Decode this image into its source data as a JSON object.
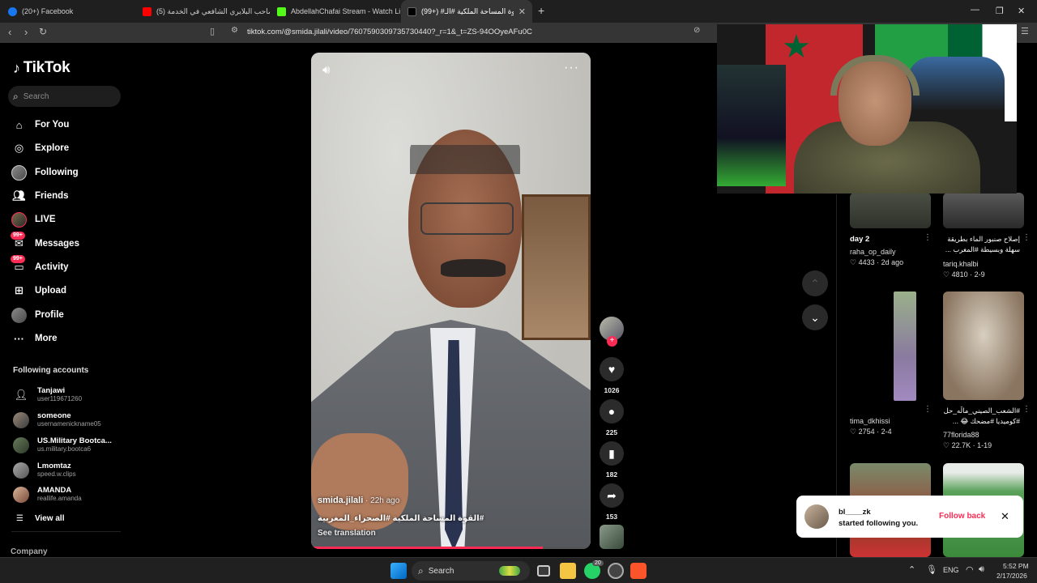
{
  "browser": {
    "tabs": [
      {
        "title": "(20+) Facebook",
        "color": "#1877f2"
      },
      {
        "title": "(5) صاحب البلايري الشافعي في الخدمة",
        "color": "#ff0000"
      },
      {
        "title": "AbdellahChafai Stream - Watch Live",
        "color": "#53fc18"
      },
      {
        "title": "(99+) #القوة المساحة الملكية #الـ",
        "color": "#000000"
      }
    ],
    "url": "tiktok.com/@smida.jilali/video/7607590309735730440?_r=1&_t=ZS-94OOyeAFu0C"
  },
  "sidebar": {
    "logo": "TikTok",
    "search_placeholder": "Search",
    "nav": [
      {
        "label": "For You",
        "icon": "home-icon"
      },
      {
        "label": "Explore",
        "icon": "compass-icon"
      },
      {
        "label": "Following",
        "icon": "avatar"
      },
      {
        "label": "Friends",
        "icon": "friends-icon"
      },
      {
        "label": "LIVE",
        "icon": "live-icon"
      },
      {
        "label": "Messages",
        "icon": "messages-icon",
        "badge": "99+"
      },
      {
        "label": "Activity",
        "icon": "activity-icon",
        "badge": "99+"
      },
      {
        "label": "Upload",
        "icon": "upload-icon"
      },
      {
        "label": "Profile",
        "icon": "avatar"
      },
      {
        "label": "More",
        "icon": "more-icon"
      }
    ],
    "following_title": "Following accounts",
    "accounts": [
      {
        "name": "Tanjawi",
        "user": "user119671260"
      },
      {
        "name": "someone",
        "user": "usernamenickname05"
      },
      {
        "name": "US.Military Bootca...",
        "user": "us.military.bootca6"
      },
      {
        "name": "Lmomtaz",
        "user": "speed.w.clips"
      },
      {
        "name": "AMANDA",
        "user": "reallife.amanda"
      }
    ],
    "view_all": "View all",
    "company": "Company"
  },
  "video": {
    "author": "smida.jilali",
    "age": " · 22h ago",
    "caption": "#القوة المساحة الملكية #الصحراء_المغربية",
    "see_translation": "See translation",
    "progress": 0.83
  },
  "actions": {
    "likes": "1026",
    "comments": "225",
    "saves": "182",
    "shares": "153"
  },
  "feed": [
    {
      "title": "day 2",
      "user": "raha_op_daily",
      "likes": "4433",
      "date": "2d ago"
    },
    {
      "title": "إصلاح صنبور الماء بطريقة سهلة وبسيطة #المغرب ...",
      "user": "tariq.khalbi",
      "likes": "4810",
      "date": "2-9"
    },
    {
      "title": "",
      "user": "tima_dkhissi",
      "likes": "2754",
      "date": "2-4"
    },
    {
      "title": "#الشعب_الصيني_مالَه_حل #كوميديا #مضحك 😂 ...",
      "user": "77florida88",
      "likes": "22.7K",
      "date": "1-19"
    }
  ],
  "notification": {
    "name": "bl____zk",
    "text": "started following you.",
    "button": "Follow back"
  },
  "taskbar": {
    "search": "Search",
    "lang": "ENG",
    "time": "5:52 PM",
    "date": "2/17/2026",
    "whatsapp_badge": "20"
  }
}
